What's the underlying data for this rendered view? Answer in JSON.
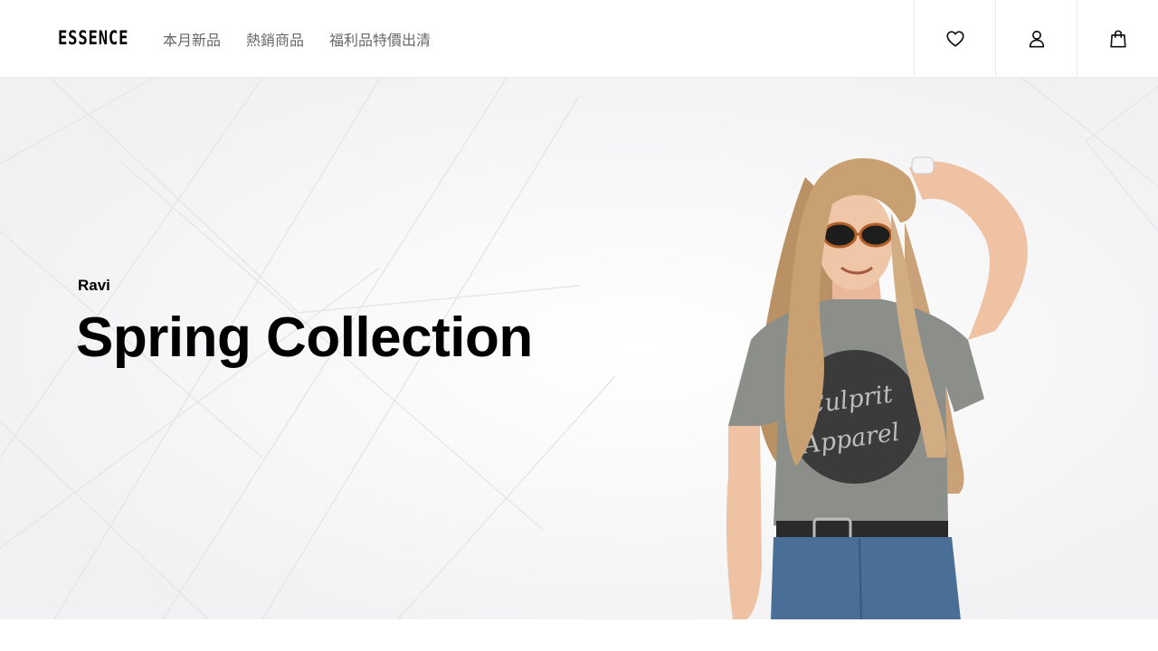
{
  "header": {
    "logo": "ESSENCE",
    "nav": [
      {
        "label": "本月新品"
      },
      {
        "label": "熱銷商品"
      },
      {
        "label": "福利品特價出清"
      }
    ],
    "icons": {
      "favorites": "heart-icon",
      "account": "user-icon",
      "cart": "shopping-bag-icon"
    }
  },
  "hero": {
    "subtitle": "Ravi",
    "title": "Spring Collection",
    "image": {
      "tshirt_text_line1": "Culprit",
      "tshirt_text_line2": "Apparel"
    }
  },
  "colors": {
    "background": "#ffffff",
    "hero_background": "#f7f7f8",
    "nav_text": "#666666",
    "border": "#ebebeb",
    "text": "#000000"
  }
}
